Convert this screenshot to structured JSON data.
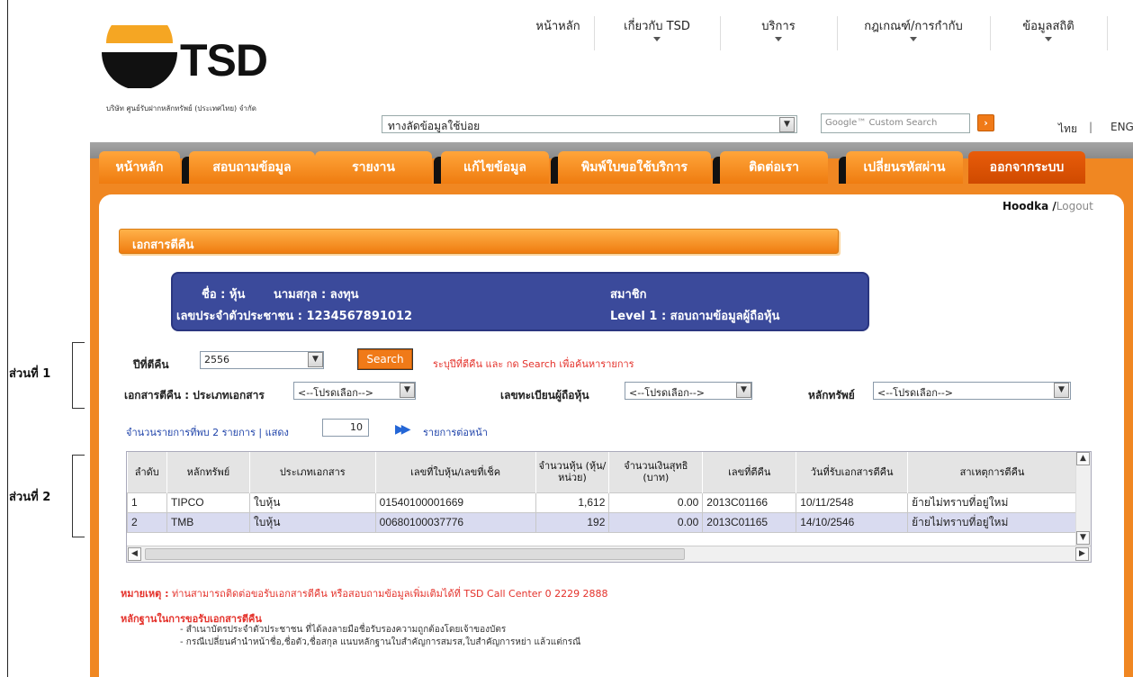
{
  "brand": {
    "name": "TSD",
    "company": "บริษัท ศูนย์รับฝากหลักทรัพย์ (ประเทศไทย) จำกัด"
  },
  "topnav": [
    {
      "label": "หน้าหลัก",
      "has_arrow": false
    },
    {
      "label": "เกี่ยวกับ TSD",
      "has_arrow": true
    },
    {
      "label": "บริการ",
      "has_arrow": true
    },
    {
      "label": "กฎเกณฑ์/การกำกับ",
      "has_arrow": true
    },
    {
      "label": "ข้อมูลสถิติ",
      "has_arrow": true
    }
  ],
  "quick_links": {
    "value": "ทางลัดข้อมูลใช้บ่อย"
  },
  "google_search": {
    "placeholder": "Google™ Custom Search"
  },
  "languages": {
    "thai": "ไทย",
    "sep": "|",
    "eng": "ENG"
  },
  "mainnav": [
    {
      "label": "หน้าหลัก"
    },
    {
      "label": "สอบถามข้อมูล"
    },
    {
      "label": "รายงาน"
    },
    {
      "label": "แก้ไขข้อมูล"
    },
    {
      "label": "พิมพ์ใบขอใช้บริการ"
    },
    {
      "label": "ติดต่อเรา"
    },
    {
      "label": "เปลี่ยนรหัสผ่าน"
    },
    {
      "label": "ออกจากระบบ"
    }
  ],
  "user": {
    "name": "Hoodka",
    "slash": " /",
    "logout": "Logout"
  },
  "section_title": "เอกสารตีคืน",
  "member_info": {
    "name": "ชื่อ : หุ้น",
    "surname": "นามสกุล : ลงทุน",
    "id": "เลขประจำตัวประชาชน : 1234567891012",
    "type": "สมาชิก",
    "level": "Level 1   : สอบถามข้อมูลผู้ถือหุ้น"
  },
  "side_labels": {
    "part1": "ส่วนที่ 1",
    "part2": "ส่วนที่ 2"
  },
  "filters": {
    "year_label": "ปีที่ตีคืน",
    "year_value": "2556",
    "search_label": "Search",
    "hint": "ระบุปีที่ตีคืน และ กด Search เพื่อค้นหารายการ",
    "doc_type_label": "เอกสารตีคืน : ประเภทเอกสาร",
    "doc_type_value": "<--โปรดเลือก-->",
    "holder_label": "เลขทะเบียนผู้ถือหุ้น",
    "holder_value": "<--โปรดเลือก-->",
    "security_label": "หลักทรัพย์",
    "security_value": "<--โปรดเลือก-->"
  },
  "paging": {
    "count_text": "จำนวนรายการที่พบ 2 รายการ | แสดง",
    "per_page": "10",
    "next": "รายการต่อหน้า"
  },
  "table": {
    "headers": [
      "ลำดับ",
      "หลักทรัพย์",
      "ประเภทเอกสาร",
      "เลขที่ใบหุ้น/เลขที่เช็ค",
      "จำนวนหุ้น (หุ้น/หน่วย)",
      "จำนวนเงินสุทธิ (บาท)",
      "เลขที่ตีคืน",
      "วันที่รับเอกสารตีคืน",
      "สาเหตุการตีคืน"
    ],
    "rows": [
      [
        "1",
        "TIPCO",
        "ใบหุ้น",
        "01540100001669",
        "1,612",
        "0.00",
        "2013C01166",
        "10/11/2548",
        "ย้ายไม่ทราบที่อยู่ใหม่"
      ],
      [
        "2",
        "TMB",
        "ใบหุ้น",
        "00680100037776",
        "192",
        "0.00",
        "2013C01165",
        "14/10/2546",
        "ย้ายไม่ทราบที่อยู่ใหม่"
      ]
    ]
  },
  "note": {
    "label": "หมายเหตุ :",
    "text": " ท่านสามารถติดต่อขอรับเอกสารตีคืน หรือสอบถามข้อมูลเพิ่มเติมได้ที่ TSD Call Center 0 2229 2888"
  },
  "proof": {
    "title": "หลักฐานในการขอรับเอกสารตีคืน",
    "items": [
      "- สำเนาบัตรประจำตัวประชาชน ที่ได้ลงลายมือชื่อรับรองความถูกต้องโดยเจ้าของบัตร",
      "- กรณีเปลี่ยนคำนำหน้าชื่อ,ชื่อตัว,ชื่อสกุล แนบหลักฐานใบสำคัญการสมรส,ใบสำคัญการหย่า แล้วแต่กรณี"
    ]
  },
  "colors": {
    "orange": "#f08722",
    "navy": "#3b4a9b",
    "red_text": "#e4322b",
    "link_blue": "#2044aa"
  }
}
